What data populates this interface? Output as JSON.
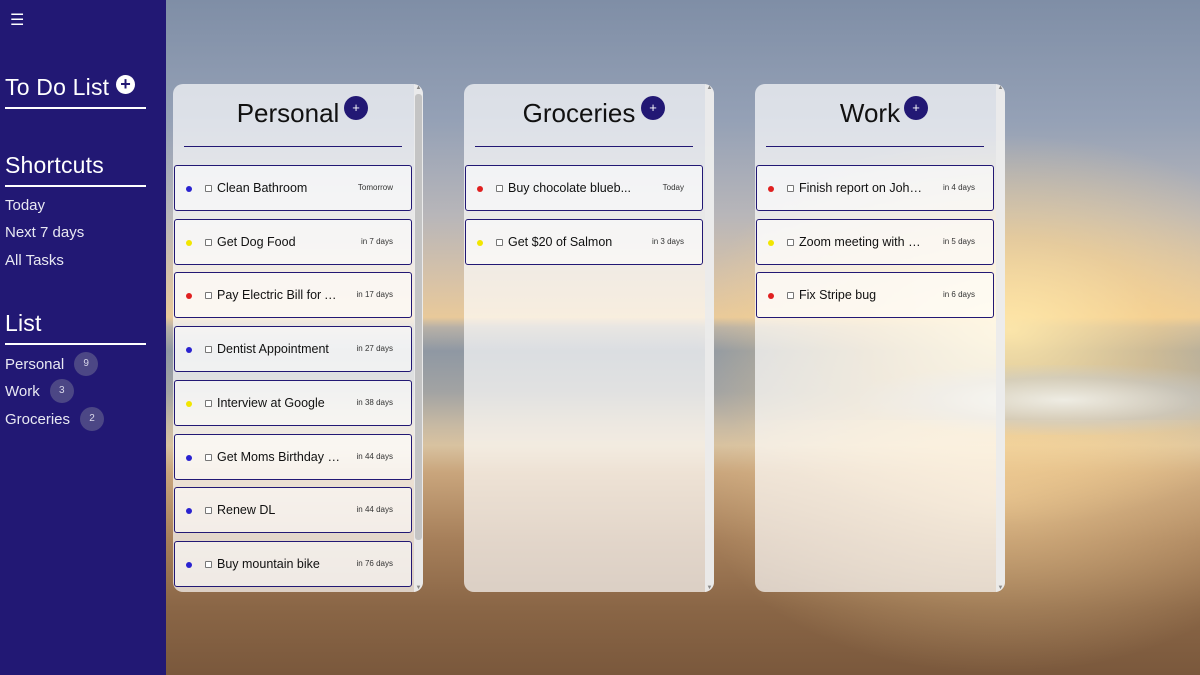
{
  "sidebar": {
    "menu_icon": "hamburger-menu-icon",
    "title": "To Do List",
    "add_icon": "plus-circle-icon",
    "shortcuts_title": "Shortcuts",
    "shortcuts": [
      "Today",
      "Next 7 days",
      "All Tasks"
    ],
    "list_title": "List",
    "lists": [
      {
        "label": "Personal",
        "count": "9"
      },
      {
        "label": "Work",
        "count": "3"
      },
      {
        "label": "Groceries",
        "count": "2"
      }
    ]
  },
  "colors": {
    "accent": "#221874",
    "priority_high": "#e02020",
    "priority_medium": "#f2e600",
    "priority_low": "#2a22d0"
  },
  "columns": [
    {
      "title": "Personal",
      "add_label": "+",
      "tasks": [
        {
          "label": "Clean Bathroom",
          "due": "Tomorrow",
          "priority": "low"
        },
        {
          "label": "Get Dog Food",
          "due": "in 7 days",
          "priority": "medium"
        },
        {
          "label": "Pay Electric Bill for Au...",
          "due": "in 17 days",
          "priority": "high"
        },
        {
          "label": "Dentist Appointment",
          "due": "in 27 days",
          "priority": "low"
        },
        {
          "label": "Interview at Google",
          "due": "in 38 days",
          "priority": "medium"
        },
        {
          "label": "Get Moms Birthday P...",
          "due": "in 44 days",
          "priority": "low"
        },
        {
          "label": "Renew DL",
          "due": "in 44 days",
          "priority": "low"
        },
        {
          "label": "Buy mountain bike",
          "due": "in 76 days",
          "priority": "low"
        }
      ]
    },
    {
      "title": "Groceries",
      "add_label": "+",
      "tasks": [
        {
          "label": "Buy chocolate blueb...",
          "due": "Today",
          "priority": "high"
        },
        {
          "label": "Get $20 of Salmon",
          "due": "in 3 days",
          "priority": "medium"
        }
      ]
    },
    {
      "title": "Work",
      "add_label": "+",
      "tasks": [
        {
          "label": "Finish report on John...",
          "due": "in 4 days",
          "priority": "high"
        },
        {
          "label": "Zoom meeting with S...",
          "due": "in 5 days",
          "priority": "medium"
        },
        {
          "label": "Fix Stripe bug",
          "due": "in 6 days",
          "priority": "high"
        }
      ]
    }
  ]
}
